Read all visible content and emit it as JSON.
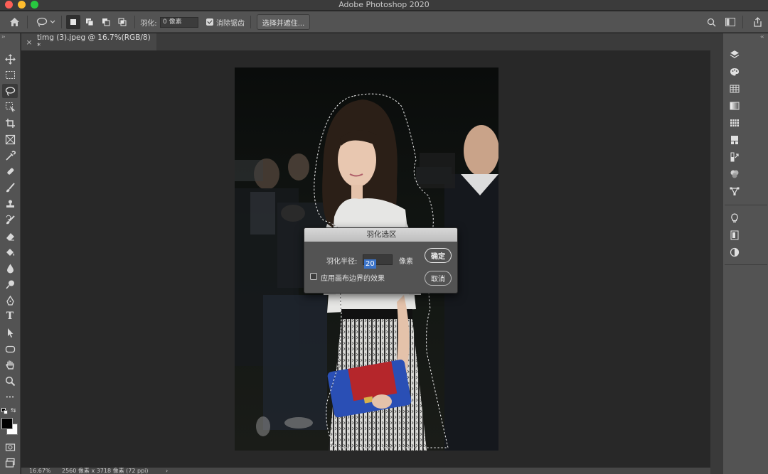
{
  "window": {
    "title": "Adobe Photoshop 2020"
  },
  "options_bar": {
    "feather_label": "羽化:",
    "feather_value": "0 像素",
    "antialias_label": "消除锯齿",
    "antialias_checked": true,
    "select_and_mask_label": "选择并遮住..."
  },
  "document": {
    "tab_label": "timg (3).jpeg @ 16.7%(RGB/8) *",
    "close_glyph": "×"
  },
  "status_bar": {
    "zoom": "16.67%",
    "size": "2560 像素 x 3718 像素 (72 ppi)",
    "more_glyph": "›"
  },
  "tools": [
    "move-tool",
    "marquee-tool",
    "lasso-tool",
    "object-select-tool",
    "crop-tool",
    "frame-tool",
    "eyedropper-tool",
    "healing-brush-tool",
    "brush-tool",
    "clone-stamp-tool",
    "history-brush-tool",
    "eraser-tool",
    "paint-bucket-tool",
    "blur-tool",
    "dodge-tool",
    "pen-tool",
    "type-tool",
    "path-select-tool",
    "shape-tool",
    "hand-tool",
    "zoom-tool",
    "more-tools"
  ],
  "active_tool": "lasso-tool",
  "tool_glyphs": {
    "type-tool": "T",
    "more-tools": "•••"
  },
  "colors": {
    "foreground": "#000000",
    "background": "#ffffff",
    "accent": "#3b73c8"
  },
  "feather_dialog": {
    "title": "羽化选区",
    "radius_label": "羽化半径:",
    "radius_value": "20",
    "unit_label": "像素",
    "apply_canvas_bounds_label": "应用画布边界的效果",
    "apply_canvas_bounds_checked": false,
    "ok_label": "确定",
    "cancel_label": "取消"
  }
}
